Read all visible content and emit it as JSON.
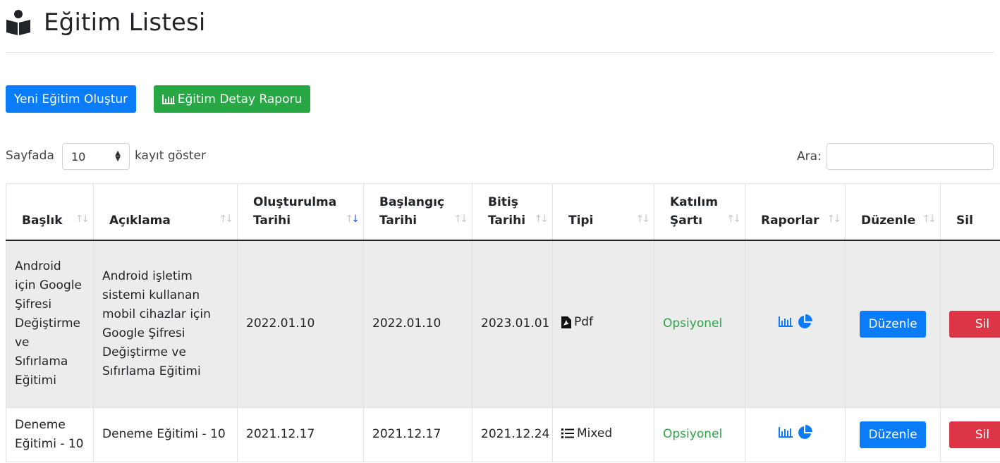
{
  "header": {
    "title": "Eğitim Listesi",
    "icon": "book-reader-icon"
  },
  "actions": {
    "new_training": "Yeni Eğitim Oluştur",
    "detail_report": "Eğitim Detay Raporu",
    "detail_report_icon": "bar-chart-icon"
  },
  "length_control": {
    "prefix": "Sayfada",
    "value": "10",
    "suffix": "kayıt göster"
  },
  "search": {
    "label": "Ara:",
    "value": ""
  },
  "table": {
    "columns": [
      "Başlık",
      "Açıklama",
      "Oluşturulma Tarihi",
      "Başlangıç Tarihi",
      "Bitiş Tarihi",
      "Tipi",
      "Katılım Şartı",
      "Raporlar",
      "Düzenle",
      "Sil"
    ],
    "sorted_column": "Oluşturulma Tarihi",
    "rows": [
      {
        "title": "Android için Google Şifresi Değiştirme ve Sıfırlama Eğitimi",
        "description": "Android işletim sistemi kullanan mobil cihazlar için Google Şifresi Değiştirme ve Sıfırlama Eğitimi",
        "created": "2022.01.10",
        "start": "2022.01.10",
        "end": "2023.01.01",
        "type": "Pdf",
        "type_icon": "file-pdf-icon",
        "requirement": "Opsiyonel",
        "edit_label": "Düzenle",
        "delete_label": "Sil"
      },
      {
        "title": "Deneme Eğitimi - 10",
        "description": "Deneme Eğitimi - 10",
        "created": "2021.12.17",
        "start": "2021.12.17",
        "end": "2021.12.24",
        "type": "Mixed",
        "type_icon": "list-icon",
        "requirement": "Opsiyonel",
        "edit_label": "Düzenle",
        "delete_label": "Sil"
      }
    ]
  },
  "colors": {
    "primary": "#0a7cf8",
    "success": "#28a745",
    "danger": "#dc3545",
    "row_stripe": "#ececec"
  }
}
